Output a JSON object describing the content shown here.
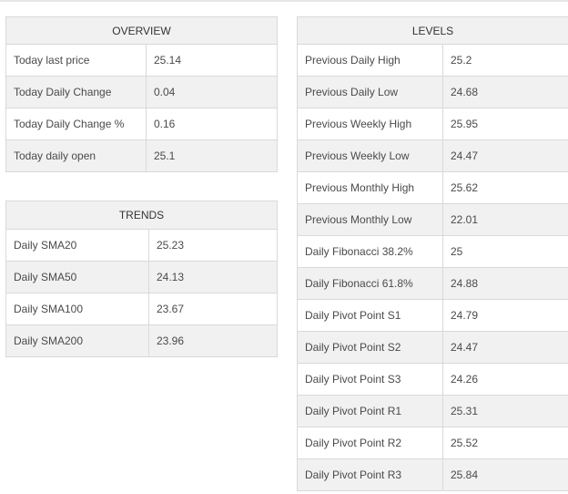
{
  "overview": {
    "title": "OVERVIEW",
    "rows": [
      {
        "label": "Today last price",
        "value": "25.14"
      },
      {
        "label": "Today Daily Change",
        "value": "0.04"
      },
      {
        "label": "Today Daily Change %",
        "value": "0.16"
      },
      {
        "label": "Today daily open",
        "value": "25.1"
      }
    ]
  },
  "trends": {
    "title": "TRENDS",
    "rows": [
      {
        "label": "Daily SMA20",
        "value": "25.23"
      },
      {
        "label": "Daily SMA50",
        "value": "24.13"
      },
      {
        "label": "Daily SMA100",
        "value": "23.67"
      },
      {
        "label": "Daily SMA200",
        "value": "23.96"
      }
    ]
  },
  "levels": {
    "title": "LEVELS",
    "rows": [
      {
        "label": "Previous Daily High",
        "value": "25.2"
      },
      {
        "label": "Previous Daily Low",
        "value": "24.68"
      },
      {
        "label": "Previous Weekly High",
        "value": "25.95"
      },
      {
        "label": "Previous Weekly Low",
        "value": "24.47"
      },
      {
        "label": "Previous Monthly High",
        "value": "25.62"
      },
      {
        "label": "Previous Monthly Low",
        "value": "22.01"
      },
      {
        "label": "Daily Fibonacci 38.2%",
        "value": "25"
      },
      {
        "label": "Daily Fibonacci 61.8%",
        "value": "24.88"
      },
      {
        "label": "Daily Pivot Point S1",
        "value": "24.79"
      },
      {
        "label": "Daily Pivot Point S2",
        "value": "24.47"
      },
      {
        "label": "Daily Pivot Point S3",
        "value": "24.26"
      },
      {
        "label": "Daily Pivot Point R1",
        "value": "25.31"
      },
      {
        "label": "Daily Pivot Point R2",
        "value": "25.52"
      },
      {
        "label": "Daily Pivot Point R3",
        "value": "25.84"
      }
    ]
  }
}
